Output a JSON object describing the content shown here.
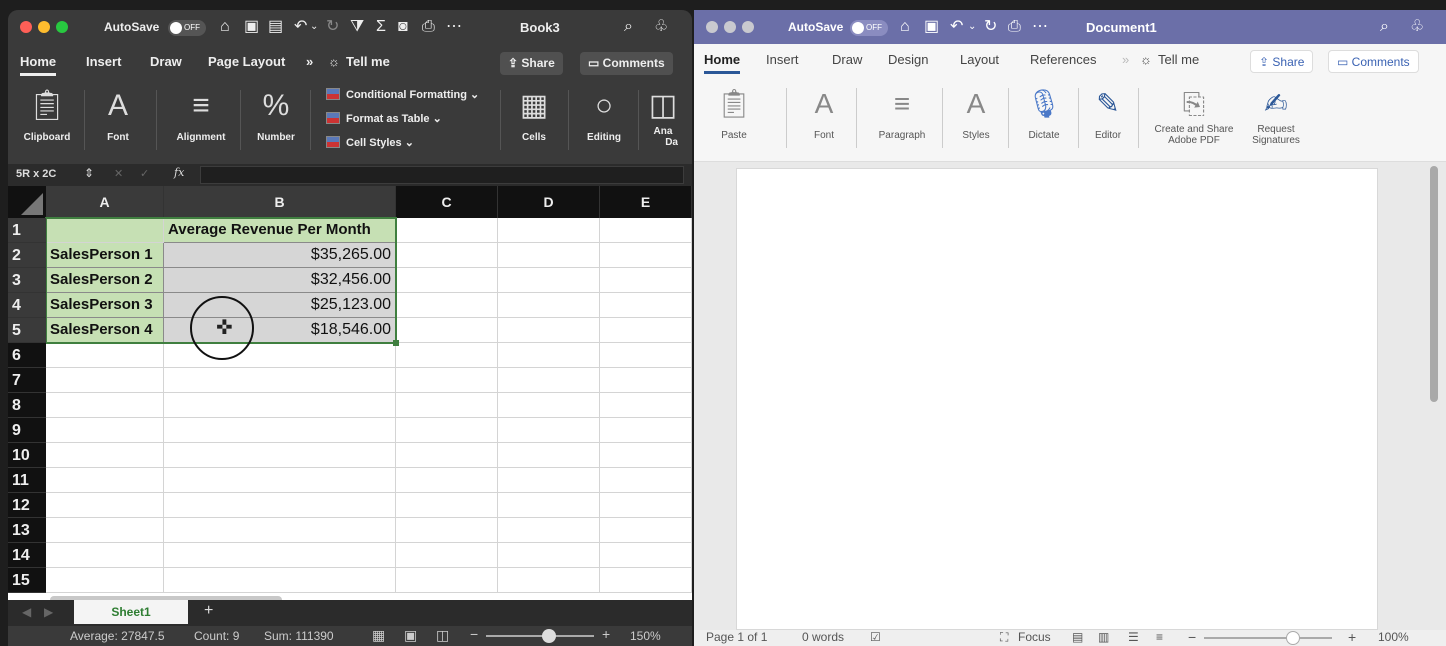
{
  "excel": {
    "titlebar": {
      "autosave_label": "AutoSave",
      "autosave_state": "OFF",
      "doc_title": "Book3"
    },
    "tabs": [
      "Home",
      "Insert",
      "Draw",
      "Page Layout",
      "»",
      "Tell me"
    ],
    "share_label": "Share",
    "comments_label": "Comments",
    "ribbon": {
      "clipboard": "Clipboard",
      "font": "Font",
      "alignment": "Alignment",
      "number": "Number",
      "conditional_formatting": "Conditional Formatting ⌄",
      "format_as_table": "Format as Table ⌄",
      "cell_styles": "Cell Styles ⌄",
      "cells": "Cells",
      "editing": "Editing",
      "analyze_1": "Ana",
      "analyze_2": "Da"
    },
    "formula_bar": {
      "name_box": "5R x 2C",
      "fx": "fx",
      "value": ""
    },
    "columns": [
      "A",
      "B",
      "C",
      "D",
      "E"
    ],
    "rows": [
      "1",
      "2",
      "3",
      "4",
      "5",
      "6",
      "7",
      "8",
      "9",
      "10",
      "11",
      "12",
      "13",
      "14",
      "15"
    ],
    "table": {
      "header_b1": "Average Revenue Per Month",
      "a": [
        "SalesPerson 1",
        "SalesPerson 2",
        "SalesPerson 3",
        "SalesPerson 4"
      ],
      "b": [
        "$35,265.00",
        "$32,456.00",
        "$25,123.00",
        "$18,546.00"
      ]
    },
    "sheet_tab": "Sheet1",
    "add_sheet": "+",
    "status": {
      "average": "Average: 27847.5",
      "count": "Count: 9",
      "sum": "Sum: 111390",
      "zoom": "150%",
      "minus": "−",
      "plus": "+"
    }
  },
  "word": {
    "titlebar": {
      "autosave_label": "AutoSave",
      "autosave_state": "OFF",
      "doc_title": "Document1"
    },
    "tabs": [
      "Home",
      "Insert",
      "Draw",
      "Design",
      "Layout",
      "References",
      "»",
      "Tell me"
    ],
    "share_label": "Share",
    "comments_label": "Comments",
    "ribbon": {
      "paste": "Paste",
      "font": "Font",
      "paragraph": "Paragraph",
      "styles": "Styles",
      "dictate": "Dictate",
      "editor": "Editor",
      "create_share_1": "Create and Share",
      "create_share_2": "Adobe PDF",
      "request_1": "Request",
      "request_2": "Signatures"
    },
    "status": {
      "page": "Page 1 of 1",
      "words": "0 words",
      "focus": "Focus",
      "zoom": "100%",
      "minus": "−",
      "plus": "+"
    }
  },
  "colors": {
    "excel_green_fill": "#c6e0b4",
    "excel_selection": "#3f7f3f",
    "word_titlebar": "#6b6fa8",
    "word_accent": "#2b5797"
  }
}
